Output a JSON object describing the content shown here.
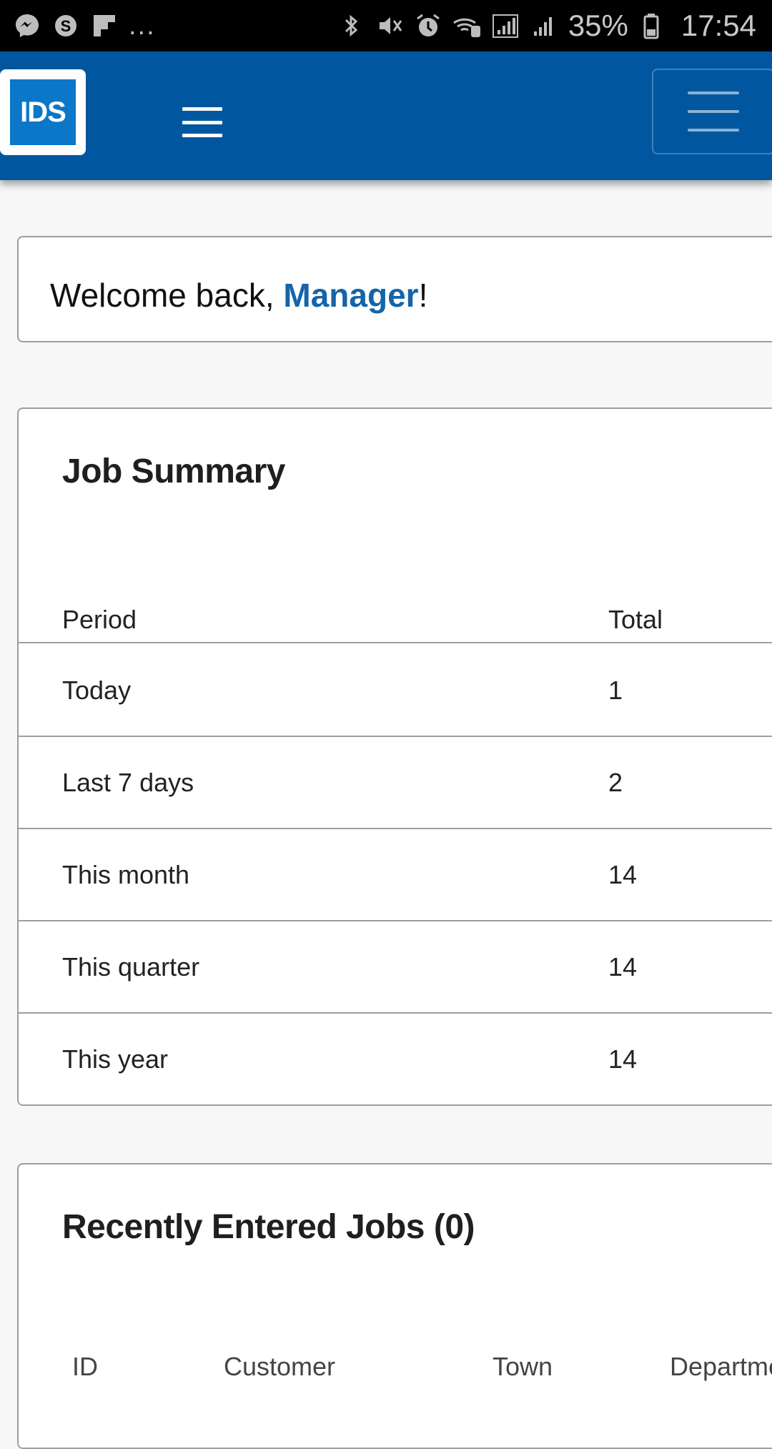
{
  "status_bar": {
    "left_icons": [
      "messenger-icon",
      "skype-icon",
      "flipboard-icon"
    ],
    "more": "...",
    "right_icons": [
      "bluetooth-icon",
      "mute-icon",
      "alarm-icon",
      "wifi-call-icon",
      "signal-icon"
    ],
    "battery_percent": "35%",
    "time": "17:54"
  },
  "header": {
    "logo_text": "IDS",
    "menu_icon": "hamburger-menu-icon",
    "toggler_icon": "navbar-toggler-icon",
    "background_color": "#00579f"
  },
  "welcome": {
    "prefix": "Welcome back, ",
    "name": "Manager",
    "suffix": "!"
  },
  "job_summary": {
    "title": "Job Summary",
    "columns": [
      "Period",
      "Total"
    ],
    "rows": [
      {
        "period": "Today",
        "total": "1"
      },
      {
        "period": "Last 7 days",
        "total": "2"
      },
      {
        "period": "This month",
        "total": "14"
      },
      {
        "period": "This quarter",
        "total": "14"
      },
      {
        "period": "This year",
        "total": "14"
      }
    ]
  },
  "recent_jobs": {
    "title": "Recently Entered Jobs (0)",
    "columns": [
      "ID",
      "Customer",
      "Town",
      "Departme"
    ]
  }
}
